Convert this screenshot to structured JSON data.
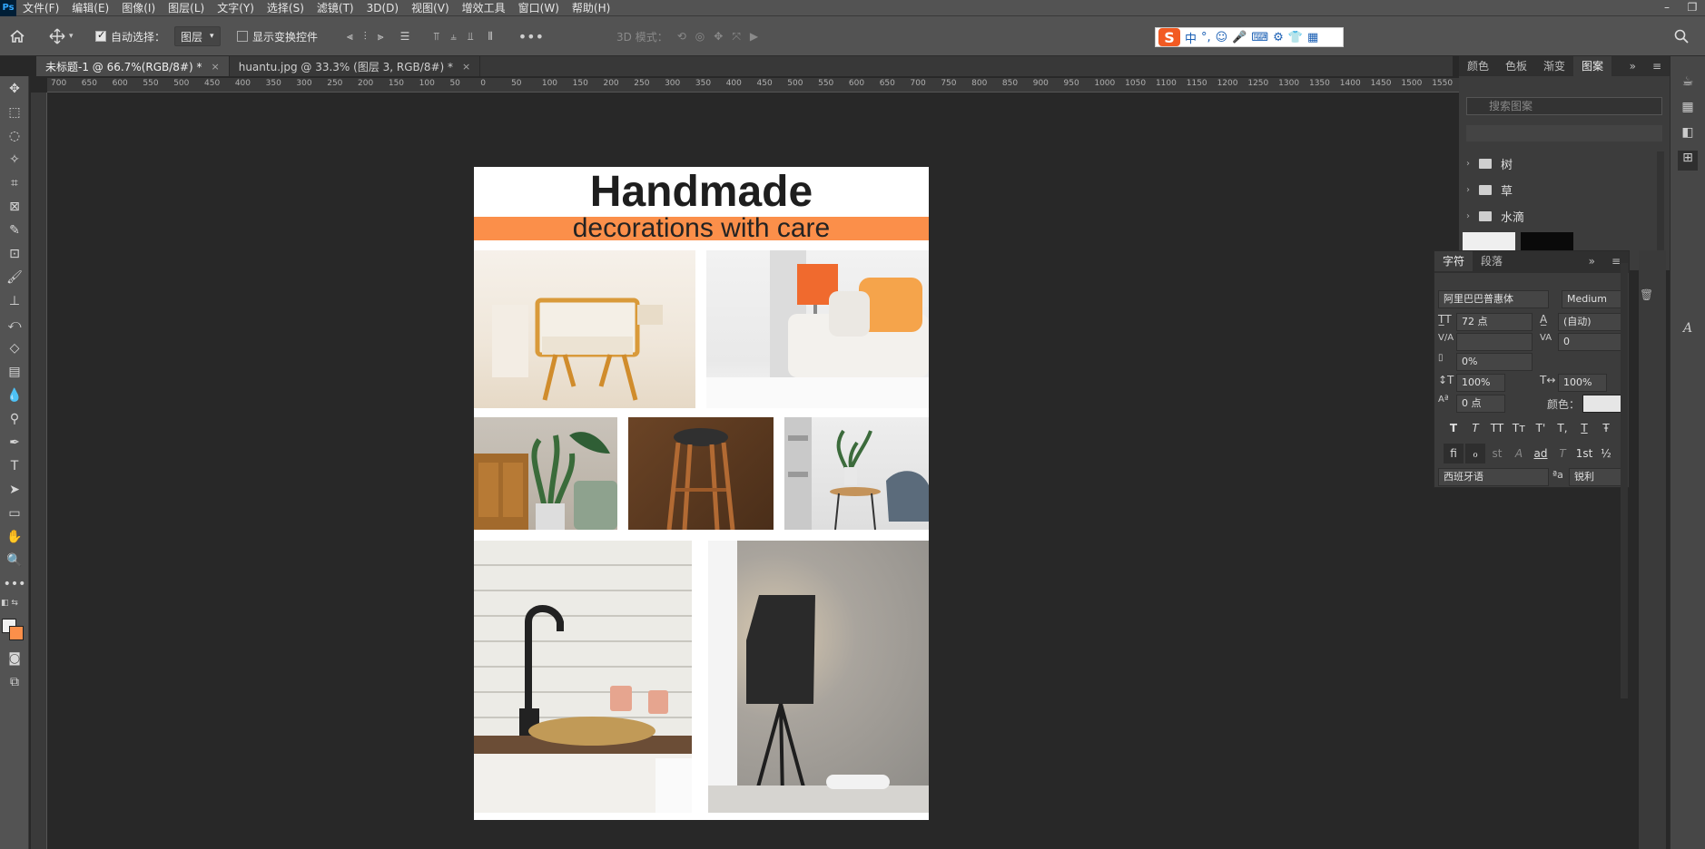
{
  "menubar": {
    "logo": "Ps",
    "items": [
      "文件(F)",
      "编辑(E)",
      "图像(I)",
      "图层(L)",
      "文字(Y)",
      "选择(S)",
      "滤镜(T)",
      "3D(D)",
      "视图(V)",
      "增效工具",
      "窗口(W)",
      "帮助(H)"
    ],
    "window_controls": [
      "–",
      "❐"
    ]
  },
  "options": {
    "auto_select_label": "自动选择：",
    "auto_select_value": "图层",
    "show_transform_label": "显示变换控件",
    "mode_3d_label": "3D 模式："
  },
  "ime": {
    "logo": "S",
    "glyphs": [
      "中",
      "°,",
      "☺",
      "🎤",
      "⌨",
      "⚙",
      "👕",
      "▦"
    ]
  },
  "tabs": [
    {
      "label": "未标题-1 @ 66.7%(RGB/8#) *",
      "close": "×"
    },
    {
      "label": "huantu.jpg @ 33.3% (图层 3, RGB/8#) *",
      "close": "×"
    }
  ],
  "ruler": {
    "ticks": [
      "700",
      "650",
      "600",
      "550",
      "500",
      "450",
      "400",
      "350",
      "300",
      "250",
      "200",
      "150",
      "100",
      "50",
      "0",
      "50",
      "100",
      "150",
      "200",
      "250",
      "300",
      "350",
      "400",
      "450",
      "500",
      "550",
      "600",
      "650",
      "700",
      "750",
      "800",
      "850",
      "900",
      "950",
      "1000",
      "1050",
      "1100",
      "1150",
      "1200",
      "1250",
      "1300",
      "1350",
      "1400",
      "1450",
      "1500",
      "1550"
    ]
  },
  "document": {
    "title": "Handmade",
    "subtitle": "decorations with care"
  },
  "patterns_panel": {
    "tabs": [
      "颜色",
      "色板",
      "渐变",
      "图案"
    ],
    "search_placeholder": "搜索图案",
    "groups": [
      "树",
      "草",
      "水滴"
    ]
  },
  "character_panel": {
    "tabs": [
      "字符",
      "段落"
    ],
    "font_family": "阿里巴巴普惠体",
    "font_style": "Medium",
    "font_size": "72 点",
    "leading": "(自动)",
    "kerning": "",
    "tracking": "0",
    "tsume": "0%",
    "vertical_scale": "100%",
    "horizontal_scale": "100%",
    "baseline_shift": "0 点",
    "color_label": "颜色：",
    "style_buttons": [
      "T",
      "T",
      "TT",
      "Tт",
      "T'",
      "T,",
      "T",
      "Ŧ"
    ],
    "opentype_buttons": [
      "ﬁ",
      "ℴ",
      "st",
      "A",
      "ad",
      "T",
      "1st",
      "½"
    ],
    "language": "西班牙语",
    "aa_label": "ªa",
    "antialias": "锐利"
  }
}
